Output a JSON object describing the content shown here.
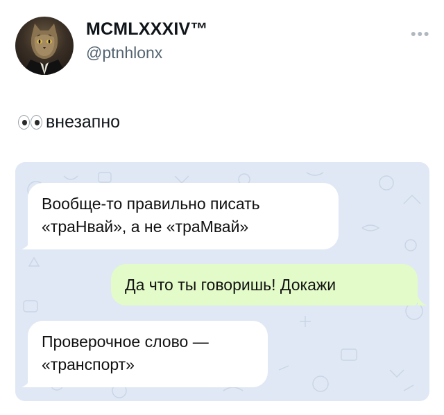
{
  "tweet": {
    "display_name": "MCMLXXXIV™",
    "handle": "@ptnhlonx",
    "more_icon": "more-icon",
    "text": "внезапно",
    "emoji": "eyes-emoji",
    "avatar_icon": "cat-in-suit-avatar"
  },
  "chat": {
    "background_color": "#dfe8f4",
    "incoming_color": "#ffffff",
    "outgoing_color": "#e3fbc9",
    "messages": [
      {
        "direction": "incoming",
        "lines": [
          "Вообще-то правильно писать",
          "«траНвай», а не «траМвай»"
        ]
      },
      {
        "direction": "outgoing",
        "lines": [
          "Да что ты говоришь! Докажи"
        ]
      },
      {
        "direction": "incoming",
        "lines": [
          "Проверочное слово —",
          "«транспорт»"
        ]
      }
    ]
  }
}
